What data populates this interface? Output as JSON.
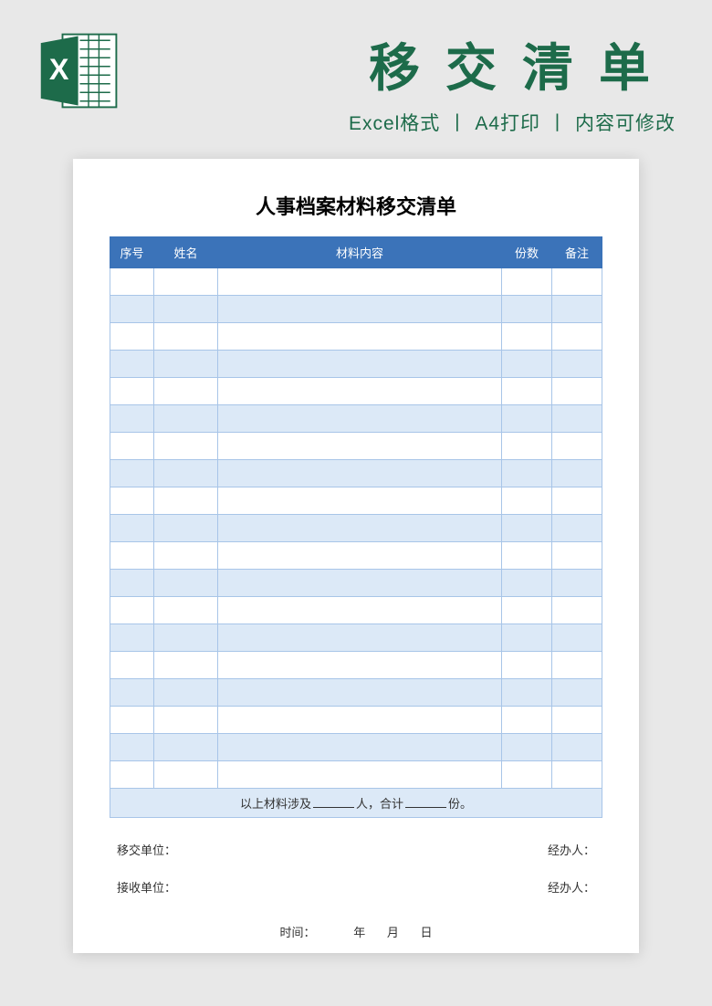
{
  "header": {
    "main_title": "移交清单",
    "sub_format": "Excel格式",
    "sub_print": "A4打印",
    "sub_edit": "内容可修改"
  },
  "document": {
    "title": "人事档案材料移交清单",
    "columns": {
      "seq": "序号",
      "name": "姓名",
      "content": "材料内容",
      "count": "份数",
      "remark": "备注"
    },
    "summary_prefix": "以上材料涉及",
    "summary_mid": "人，合计",
    "summary_suffix": "份。",
    "footer": {
      "transfer_unit": "移交单位：",
      "receive_unit": "接收单位：",
      "handler": "经办人：",
      "time_label": "时间：",
      "year": "年",
      "month": "月",
      "day": "日"
    }
  }
}
